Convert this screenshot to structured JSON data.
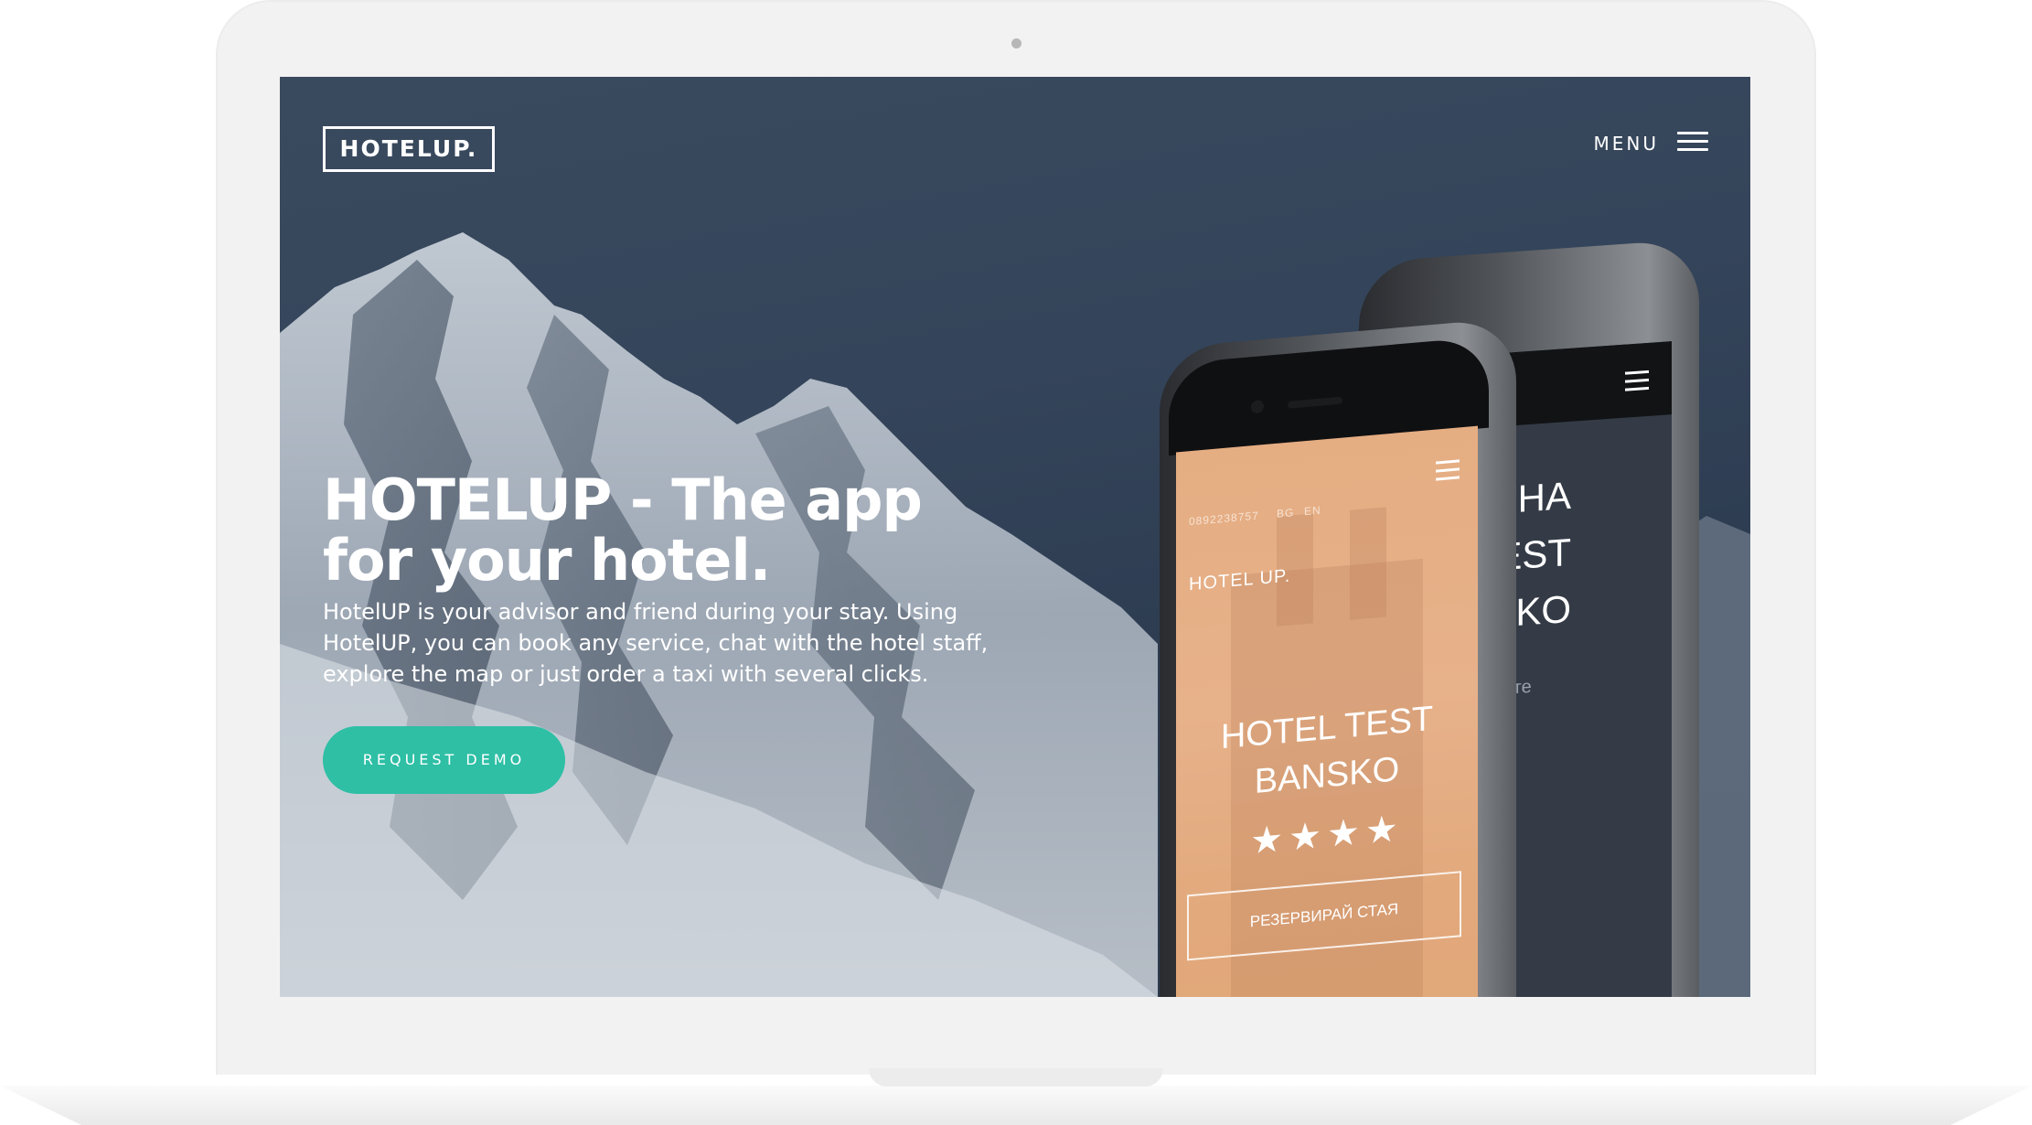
{
  "site": {
    "logo": "HOTELUP.",
    "menu_label": "MENU"
  },
  "hero": {
    "title": "HOTELUP - The app for your hotel.",
    "description": "HotelUP is your advisor and friend during your stay. Using HotelUP, you can book any service, chat with the hotel staff, explore the map or just order a taxi with several clicks.",
    "cta_label": "REQUEST DEMO"
  },
  "phone_front": {
    "phone_number": "0892238757",
    "lang_bg": "BG",
    "lang_en": "EN",
    "logo": "HOTEL UP.",
    "hotel_name": "HOTEL TEST\nBANSKO",
    "stars": "★★★★",
    "book_button": "РЕЗЕРВИРАЙ СТАЯ"
  },
  "phone_back": {
    "heading": "ИЯ НА\nEL TEST\nKO",
    "subtext": "е да резервирате\nи формуляра!"
  },
  "colors": {
    "accent": "#2ebfa5",
    "screen_bg": "#34445a",
    "phone_screen": "#e5ad82"
  },
  "icons": {
    "menu": "hamburger-icon",
    "camera": "camera-icon"
  }
}
